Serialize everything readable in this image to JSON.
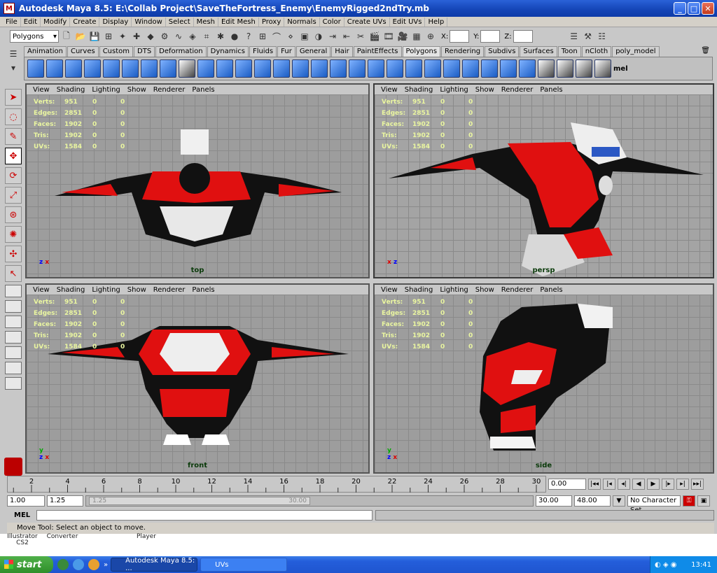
{
  "window": {
    "title": "Autodesk Maya 8.5: E:\\Collab Project\\SaveTheFortress_Enemy\\EnemyRigged2ndTry.mb",
    "minimize": "_",
    "maximize": "□",
    "close": "✕"
  },
  "menubar": [
    "File",
    "Edit",
    "Modify",
    "Create",
    "Display",
    "Window",
    "Select",
    "Mesh",
    "Edit Mesh",
    "Proxy",
    "Normals",
    "Color",
    "Create UVs",
    "Edit UVs",
    "Help"
  ],
  "statusline": {
    "mode": "Polygons",
    "x_label": "X:",
    "y_label": "Y:",
    "z_label": "Z:"
  },
  "shelf_tabs": [
    "Animation",
    "Curves",
    "Custom",
    "DTS",
    "Deformation",
    "Dynamics",
    "Fluids",
    "Fur",
    "General",
    "Hair",
    "PaintEffects",
    "Polygons",
    "Rendering",
    "Subdivs",
    "Surfaces",
    "Toon",
    "nCloth",
    "poly_model"
  ],
  "shelf_active": "Polygons",
  "shelf_mel": "mel",
  "panel_menu": [
    "View",
    "Shading",
    "Lighting",
    "Show",
    "Renderer",
    "Panels"
  ],
  "hud": {
    "labels": [
      "Verts:",
      "Edges:",
      "Faces:",
      "Tris:",
      "UVs:"
    ],
    "values": [
      "951",
      "2851",
      "1902",
      "1902",
      "1584"
    ],
    "zero": "0"
  },
  "viewports": [
    "top",
    "persp",
    "front",
    "side"
  ],
  "axes": {
    "top": [
      "z",
      "x"
    ],
    "persp": [
      "x",
      "z"
    ],
    "front": [
      "y",
      "z",
      "x"
    ],
    "side": [
      "y",
      "z",
      "x"
    ]
  },
  "timeline": {
    "ticks": [
      "2",
      "4",
      "6",
      "8",
      "10",
      "12",
      "14",
      "16",
      "18",
      "20",
      "22",
      "24",
      "26",
      "28",
      "30"
    ],
    "current": "0.00"
  },
  "range": {
    "start": "1.00",
    "inner_start": "1.25",
    "slider_start": "1.25",
    "slider_end": "30.00",
    "inner_end": "30.00",
    "end": "48.00",
    "character_set": "No Character Set"
  },
  "command": {
    "label": "MEL",
    "help": "Move Tool: Select an object to move."
  },
  "desktop_icons": [
    "Illustrator CS2",
    "Converter",
    "",
    "Player"
  ],
  "taskbar": {
    "start": "start",
    "tasks": [
      "Autodesk Maya 8.5: ...",
      "UVs"
    ],
    "clock": "13:41"
  }
}
